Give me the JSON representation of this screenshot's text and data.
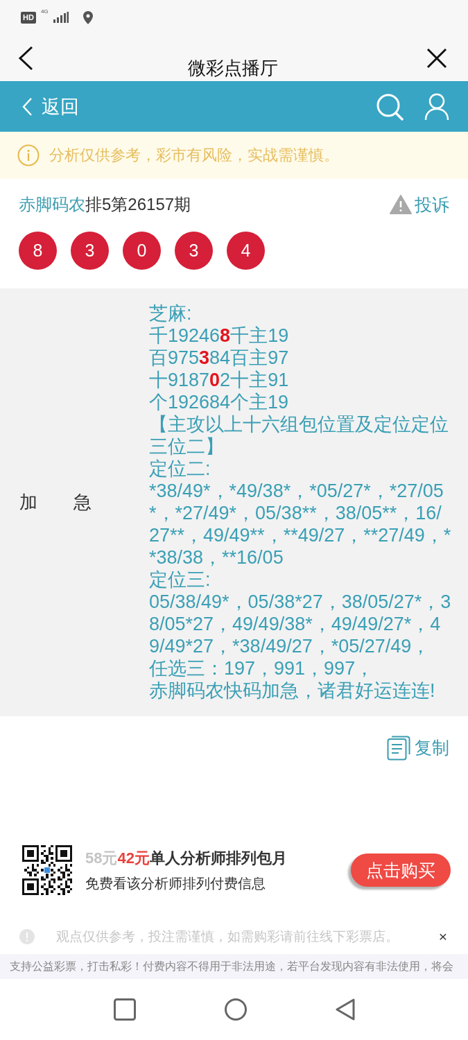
{
  "status_bar": {
    "badge": "HD",
    "network": "4G"
  },
  "title_bar": {
    "title": "微彩点播厅"
  },
  "header": {
    "back_label": "返回"
  },
  "notice": {
    "text": "分析仅供参考，彩市有风险，实战需谨慎。"
  },
  "issue": {
    "author": "赤脚码农",
    "title": "排5第26157期",
    "complaint_label": "投诉",
    "numbers": [
      "8",
      "3",
      "0",
      "3",
      "4"
    ]
  },
  "tip": {
    "label": "加　　急",
    "lines": [
      {
        "segments": [
          {
            "text": "芝麻:",
            "highlighted": false
          }
        ]
      },
      {
        "segments": [
          {
            "text": "千19246",
            "highlighted": false
          },
          {
            "text": "8",
            "highlighted": true
          },
          {
            "text": "千主19",
            "highlighted": false
          }
        ]
      },
      {
        "segments": [
          {
            "text": "百975",
            "highlighted": false
          },
          {
            "text": "3",
            "highlighted": true
          },
          {
            "text": "84百主97",
            "highlighted": false
          }
        ]
      },
      {
        "segments": [
          {
            "text": "十9187",
            "highlighted": false
          },
          {
            "text": "0",
            "highlighted": true
          },
          {
            "text": "2十主91",
            "highlighted": false
          }
        ]
      },
      {
        "segments": [
          {
            "text": "个192684个主19",
            "highlighted": false
          }
        ]
      },
      {
        "segments": [
          {
            "text": "【主攻以上十六组包位置及定位定位三位二】",
            "highlighted": false
          }
        ]
      },
      {
        "segments": [
          {
            "text": "定位二:",
            "highlighted": false
          }
        ]
      },
      {
        "segments": [
          {
            "text": "*38/49*，*49/38*，*05/27*，*27/05*，*27/49*，05/38**，38/05**，16/27**，49/49**，**49/27，**27/49，**38/38，**16/05",
            "highlighted": false
          }
        ]
      },
      {
        "segments": [
          {
            "text": "定位三:",
            "highlighted": false
          }
        ]
      },
      {
        "segments": [
          {
            "text": "05/38/49*，05/38*27，38/05/27*，38/05*27，49/49/38*，49/49/27*，49/49*27，*38/49/27，*05/27/49，",
            "highlighted": false
          }
        ]
      },
      {
        "segments": [
          {
            "text": "任选三：197，991，997，",
            "highlighted": false
          }
        ]
      },
      {
        "segments": [
          {
            "text": "赤脚码农快码加急，诸君好运连连!",
            "highlighted": false
          }
        ]
      }
    ]
  },
  "copy_label": "复制",
  "promo": {
    "old_price": "58元",
    "price": "42元",
    "title": "单人分析师排列包月",
    "subtitle": "免费看该分析师排列付费信息",
    "button": "点击购买"
  },
  "disclaimer": {
    "text": "观点仅供参考，投注需谨慎，如需购彩请前往线下彩票店。",
    "close": "×"
  },
  "footer_notice": "支持公益彩票，打击私彩！付费内容不得用于非法用途，若平台发现内容有非法使用，将会"
}
